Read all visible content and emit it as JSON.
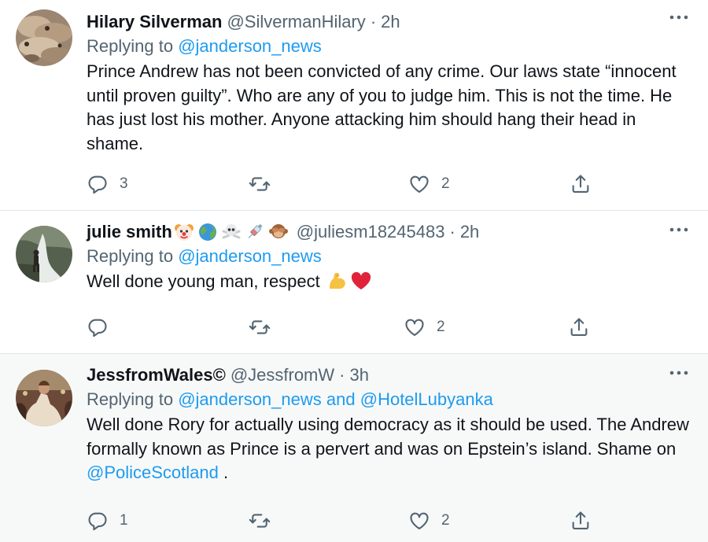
{
  "tweets": [
    {
      "name": "Hilary Silverman",
      "handle": "@SilvermanHilary",
      "separator": "·",
      "time": "2h",
      "replying_prefix": "Replying to",
      "replying_to": "@janderson_news",
      "text": "Prince Andrew has not been convicted of any crime. Our laws state “innocent until proven guilty”. Who are any of you to judge him. This is not the time. He has just lost his mother. Anyone attacking him should hang their head in shame.",
      "replies": "3",
      "retweets": "",
      "likes": "2"
    },
    {
      "name": "julie smith",
      "name_emojis": [
        "clown-face",
        "globe",
        "skull-crossbones",
        "syringe",
        "see-no-evil-monkey"
      ],
      "handle": "@juliesm18245483",
      "separator": "·",
      "time": "2h",
      "replying_prefix": "Replying to",
      "replying_to": "@janderson_news",
      "text": "Well done young man, respect",
      "text_emojis": [
        "flexed-biceps",
        "red-heart"
      ],
      "replies": "",
      "retweets": "",
      "likes": "2"
    },
    {
      "name": "JessfromWales©",
      "handle": "@JessfromW",
      "separator": "·",
      "time": "3h",
      "replying_prefix": "Replying to",
      "replying_to": "@janderson_news",
      "replying_joiner": "and",
      "replying_to_2": "@HotelLubyanka",
      "text": "Well done Rory for actually using democracy as it should be used. The Andrew formally known as Prince is a pervert and was on Epstein’s island. Shame on",
      "text_mention": "@PoliceScotland",
      "text_suffix": " .",
      "replies": "1",
      "retweets": "",
      "likes": "2"
    }
  ],
  "colors": {
    "text": "#0f1419",
    "secondary": "#536471",
    "link": "#1d9bf0",
    "divider": "#e1e6ea",
    "highlight_bg": "#f7f9f9"
  },
  "icons": [
    "reply-icon",
    "retweet-icon",
    "like-icon",
    "share-icon",
    "more-icon"
  ]
}
